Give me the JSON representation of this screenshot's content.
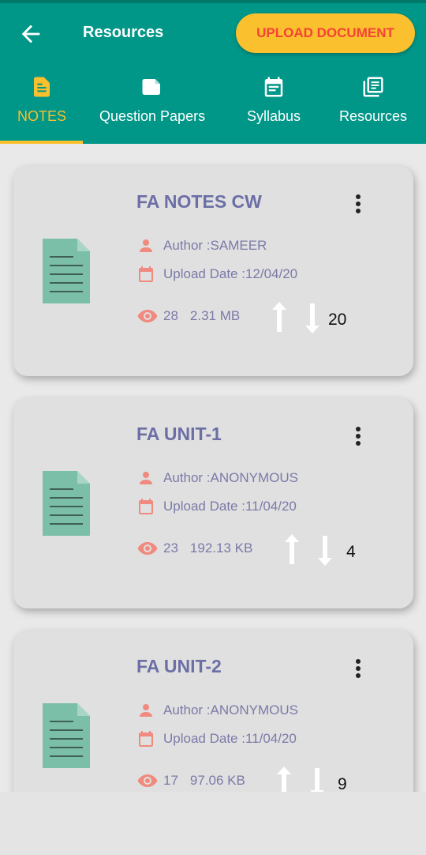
{
  "appbar": {
    "title": "Resources",
    "upload_button": "UPLOAD DOCUMENT",
    "back_icon": "arrow-back-icon"
  },
  "tabs": [
    {
      "label": "NOTES",
      "icon": "notes-icon",
      "active": true
    },
    {
      "label": "Question Papers",
      "icon": "question-papers-icon",
      "active": false
    },
    {
      "label": "Syllabus",
      "icon": "calendar-icon",
      "active": false
    },
    {
      "label": "Resources",
      "icon": "library-icon",
      "active": false
    }
  ],
  "colors": {
    "primary": "#009688",
    "accent": "#fbc02d",
    "upload_text": "#f44336",
    "card_title": "#6c6fa6",
    "meta_icon": "#f08a7e",
    "doc_icon": "#7cbfa8"
  },
  "cards": [
    {
      "title": "FA NOTES CW",
      "author": "Author :SAMEER",
      "date": "Upload Date :12/04/20",
      "views": "28",
      "size": "2.31 MB",
      "votes": "20"
    },
    {
      "title": "FA UNIT-1",
      "author": "Author :ANONYMOUS",
      "date": "Upload Date :11/04/20",
      "views": "23",
      "size": "192.13 KB",
      "votes": "4"
    },
    {
      "title": "FA UNIT-2",
      "author": "Author :ANONYMOUS",
      "date": "Upload Date :11/04/20",
      "views": "17",
      "size": "97.06 KB",
      "votes": "9"
    }
  ]
}
